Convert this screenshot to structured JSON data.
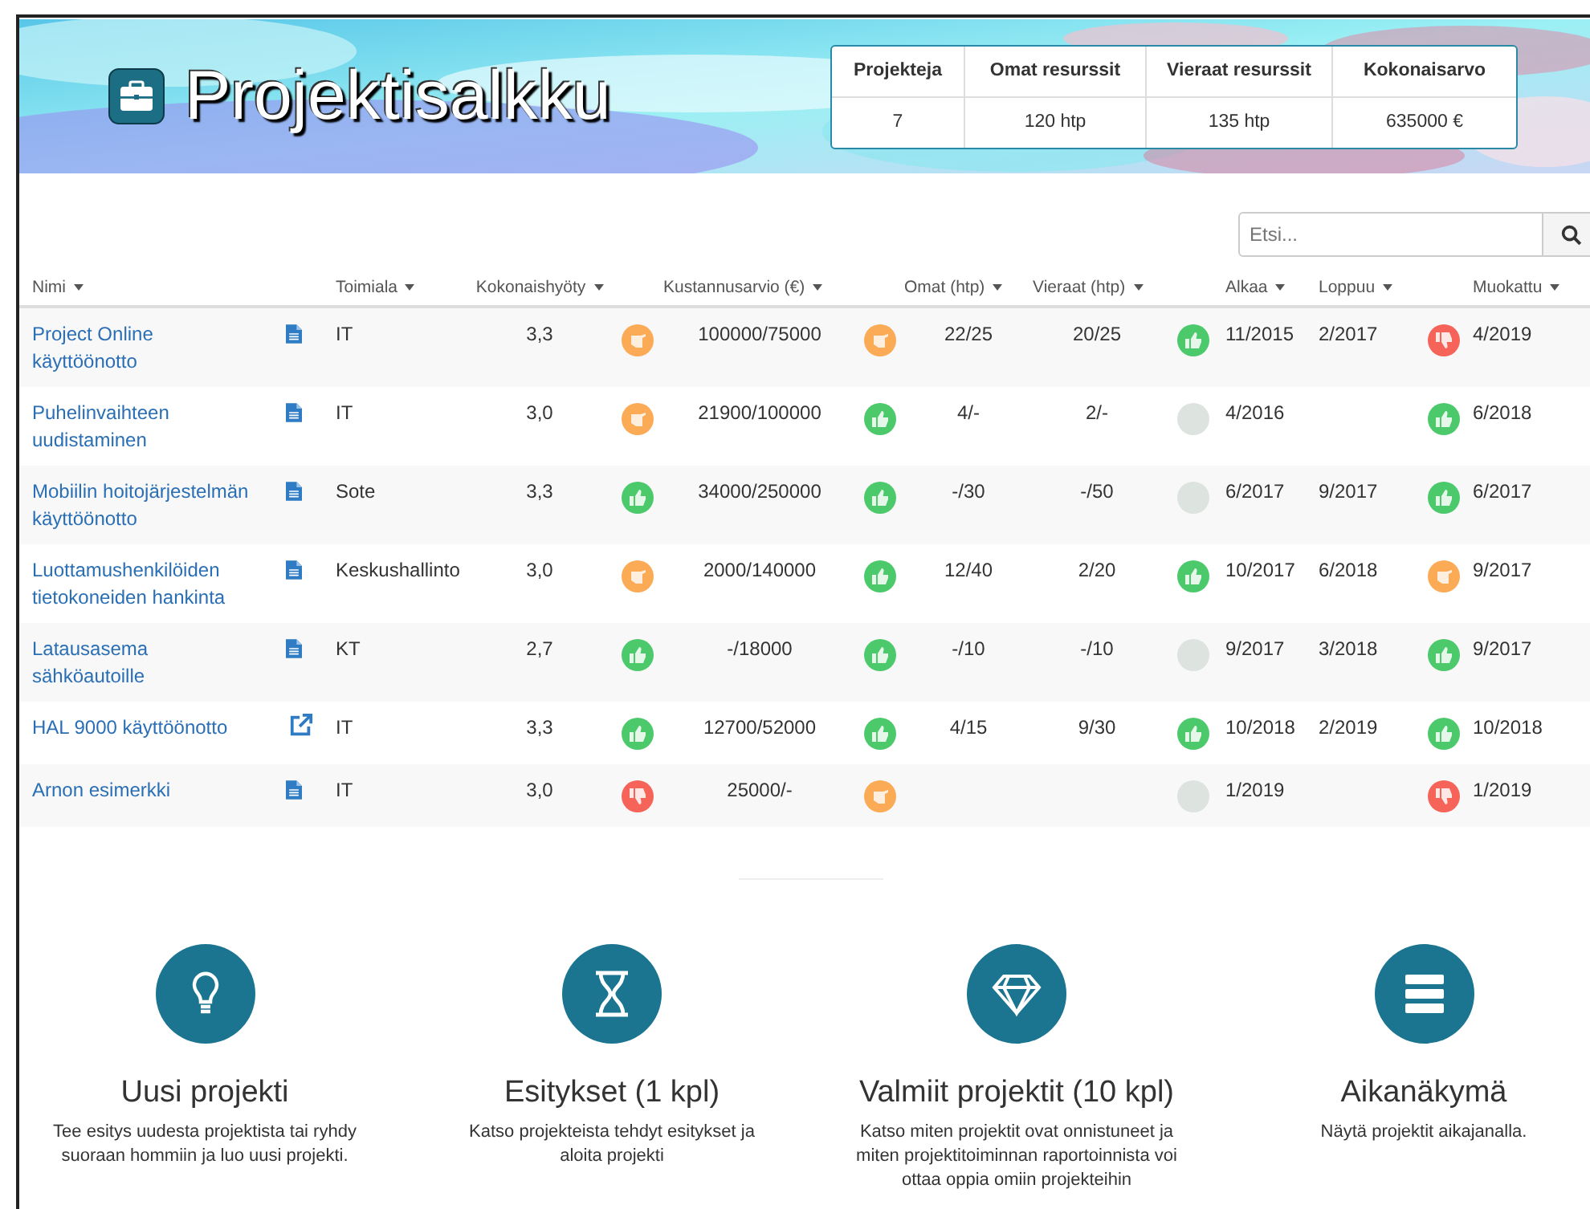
{
  "header": {
    "title": "Projektisalkku",
    "stats": {
      "columns": [
        "Projekteja",
        "Omat resurssit",
        "Vieraat resurssit",
        "Kokonaisarvo"
      ],
      "values": [
        "7",
        "120 htp",
        "135 htp",
        "635000 €"
      ]
    }
  },
  "search": {
    "placeholder": "Etsi..."
  },
  "table": {
    "columns": [
      "Nimi",
      "Toimiala",
      "Kokonaishyöty",
      "Kustannusarvio (€)",
      "Omat (htp)",
      "Vieraat (htp)",
      "Alkaa",
      "Loppuu",
      "Muokattu"
    ],
    "rows": [
      {
        "name": "Project Online käyttöönotto",
        "link": {
          "kind": "document"
        },
        "sector": "IT",
        "benefit": "3,3",
        "benefit_rating": {
          "kind": "neutral"
        },
        "cost": "100000/75000",
        "cost_rating": {
          "kind": "neutral"
        },
        "own": "22/25",
        "external": "20/25",
        "resource_rating": {
          "kind": "good"
        },
        "start": "11/2015",
        "end": "2/2017",
        "schedule_rating": {
          "kind": "bad"
        },
        "modified": "4/2019"
      },
      {
        "name": "Puhelinvaihteen uudistaminen",
        "link": {
          "kind": "document"
        },
        "sector": "IT",
        "benefit": "3,0",
        "benefit_rating": {
          "kind": "neutral"
        },
        "cost": "21900/100000",
        "cost_rating": {
          "kind": "good"
        },
        "own": "4/-",
        "external": "2/-",
        "resource_rating": {
          "kind": "none"
        },
        "start": "4/2016",
        "schedule_rating": {
          "kind": "good"
        },
        "modified": "6/2018"
      },
      {
        "name": "Mobiilin hoitojärjestelmän käyttöönotto",
        "link": {
          "kind": "document"
        },
        "sector": "Sote",
        "benefit": "3,3",
        "benefit_rating": {
          "kind": "good"
        },
        "cost": "34000/250000",
        "cost_rating": {
          "kind": "good"
        },
        "own": "-/30",
        "external": "-/50",
        "resource_rating": {
          "kind": "none"
        },
        "start": "6/2017",
        "end": "9/2017",
        "schedule_rating": {
          "kind": "good"
        },
        "modified": "6/2017"
      },
      {
        "name": "Luottamushenkilöiden tietokoneiden hankinta",
        "link": {
          "kind": "document"
        },
        "sector": "Keskushallinto",
        "benefit": "3,0",
        "benefit_rating": {
          "kind": "neutral"
        },
        "cost": "2000/140000",
        "cost_rating": {
          "kind": "good"
        },
        "own": "12/40",
        "external": "2/20",
        "resource_rating": {
          "kind": "good"
        },
        "start": "10/2017",
        "end": "6/2018",
        "schedule_rating": {
          "kind": "neutral"
        },
        "modified": "9/2017"
      },
      {
        "name": "Latausasema sähköautoille",
        "link": {
          "kind": "document"
        },
        "sector": "KT",
        "benefit": "2,7",
        "benefit_rating": {
          "kind": "good"
        },
        "cost": "-/18000",
        "cost_rating": {
          "kind": "good"
        },
        "own": "-/10",
        "external": "-/10",
        "resource_rating": {
          "kind": "none"
        },
        "start": "9/2017",
        "end": "3/2018",
        "schedule_rating": {
          "kind": "good"
        },
        "modified": "9/2017"
      },
      {
        "name": "HAL 9000 käyttöönotto",
        "link": {
          "kind": "external"
        },
        "sector": "IT",
        "benefit": "3,3",
        "benefit_rating": {
          "kind": "good"
        },
        "cost": "12700/52000",
        "cost_rating": {
          "kind": "good"
        },
        "own": "4/15",
        "external": "9/30",
        "resource_rating": {
          "kind": "good"
        },
        "start": "10/2018",
        "end": "2/2019",
        "schedule_rating": {
          "kind": "good"
        },
        "modified": "10/2018"
      },
      {
        "name": "Arnon esimerkki",
        "link": {
          "kind": "document"
        },
        "sector": "IT",
        "benefit": "3,0",
        "benefit_rating": {
          "kind": "bad"
        },
        "cost": "25000/-",
        "cost_rating": {
          "kind": "neutral"
        },
        "resource_rating": {
          "kind": "none"
        },
        "start": "1/2019",
        "schedule_rating": {
          "kind": "bad"
        },
        "modified": "1/2019"
      }
    ]
  },
  "features": [
    {
      "kind": "lightbulb",
      "title": "Uusi projekti",
      "text": "Tee esitys uudesta projektista tai ryhdy suoraan hommiin ja luo uusi projekti."
    },
    {
      "kind": "hourglass",
      "title": "Esitykset (1 kpl)",
      "text": "Katso projekteista tehdyt esitykset ja aloita projekti"
    },
    {
      "kind": "diamond",
      "title": "Valmiit projektit (10 kpl)",
      "text": "Katso miten projektit ovat onnistuneet ja miten projektitoiminnan raportoinnista voi ottaa oppia omiin projekteihin"
    },
    {
      "kind": "list",
      "title": "Aikanäkymä",
      "text": "Näytä projektit aikajanalla."
    }
  ]
}
